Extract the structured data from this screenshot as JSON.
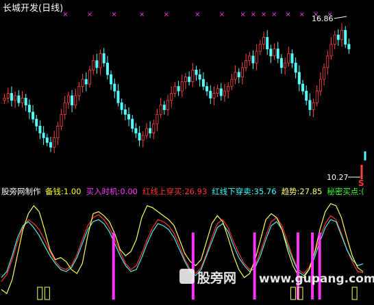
{
  "upper": {
    "title": "长城开发(日线)",
    "high_label": "16.86",
    "low_label": "10.27",
    "s_marker": "S"
  },
  "lower": {
    "source": "股旁网制作",
    "legend": [
      {
        "text": "备钱:1.00",
        "color": "#ffff00"
      },
      {
        "text": "买入时机:0.00",
        "color": "#ff33ff"
      },
      {
        "text": "红线上穿买:26.93",
        "color": "#ff3333"
      },
      {
        "text": "红线下穿卖:35.76",
        "color": "#33ffff"
      },
      {
        "text": "趋势:27.85",
        "color": "#ffff66"
      },
      {
        "text": "秘密买点:(",
        "color": "#33ff33"
      }
    ]
  },
  "watermark": {
    "brand": "股旁网",
    "url": "www.gupang.com"
  },
  "colors": {
    "up": "#ff4444",
    "down": "#54ffff",
    "magenta": "#ff33ff",
    "yellow": "#ffff55",
    "red": "#ff3333",
    "cyan": "#4df0f0"
  },
  "chart_data": [
    {
      "type": "candlestick",
      "title": "长城开发(日线)",
      "ylim": [
        10.27,
        16.86
      ],
      "annotations": [
        {
          "text": "16.86",
          "kind": "high"
        },
        {
          "text": "10.27",
          "kind": "low"
        }
      ],
      "closes": [
        13.5,
        13.7,
        13.4,
        13.6,
        13.3,
        13.5,
        13.2,
        12.9,
        12.6,
        12.3,
        12.0,
        11.8,
        11.6,
        11.4,
        11.8,
        12.3,
        12.8,
        13.3,
        13.6,
        13.2,
        13.6,
        14.0,
        14.3,
        14.1,
        14.7,
        15.1,
        14.8,
        15.4,
        15.0,
        14.5,
        14.1,
        13.8,
        13.3,
        13.0,
        12.8,
        12.6,
        12.2,
        12.0,
        11.7,
        11.9,
        12.2,
        12.0,
        12.4,
        12.8,
        13.2,
        13.0,
        13.4,
        13.7,
        14.0,
        13.8,
        14.2,
        14.4,
        14.2,
        14.7,
        14.5,
        14.3,
        14.0,
        13.8,
        13.5,
        13.7,
        13.9,
        13.6,
        13.8,
        14.0,
        14.3,
        14.6,
        14.4,
        14.8,
        15.1,
        15.3,
        15.0,
        15.5,
        15.8,
        16.1,
        15.6,
        15.3,
        15.6,
        15.2,
        14.8,
        15.0,
        15.4,
        15.0,
        14.6,
        14.1,
        13.8,
        13.4,
        13.0,
        13.3,
        13.8,
        14.3,
        14.8,
        15.3,
        15.8,
        16.2,
        16.0,
        16.4,
        15.8,
        15.6
      ],
      "markers": [
        0.18,
        0.25,
        0.32,
        0.4,
        0.47,
        0.56,
        0.63,
        0.69,
        0.72,
        0.75,
        0.78,
        0.82,
        0.86,
        0.9,
        0.94
      ],
      "tail_bars": [
        {
          "open": 10.9,
          "close": 10.27,
          "color": "up"
        },
        {
          "open": 11.1,
          "close": 11.5,
          "color": "down"
        }
      ]
    },
    {
      "type": "line",
      "ylim": [
        0,
        100
      ],
      "series": [
        {
          "name": "红线上穿买",
          "color": "red",
          "values": [
            18,
            25,
            40,
            58,
            72,
            80,
            76,
            70,
            60,
            48,
            38,
            32,
            30,
            34,
            45,
            60,
            74,
            82,
            85,
            80,
            72,
            60,
            48,
            36,
            30,
            34,
            46,
            60,
            72,
            80,
            78,
            74,
            66,
            54,
            40,
            30,
            26,
            32,
            46,
            62,
            76,
            80,
            72,
            58,
            46,
            36,
            30,
            34,
            48,
            64,
            78,
            82,
            74,
            58,
            42,
            30,
            26,
            32,
            46,
            62,
            76,
            84,
            80,
            66,
            50,
            38,
            28,
            26.93
          ]
        },
        {
          "name": "红线下穿卖",
          "color": "cyan",
          "values": [
            22,
            28,
            44,
            62,
            74,
            78,
            72,
            64,
            54,
            44,
            36,
            30,
            28,
            32,
            42,
            56,
            70,
            78,
            80,
            76,
            68,
            56,
            44,
            34,
            28,
            30,
            42,
            56,
            68,
            76,
            74,
            70,
            62,
            50,
            38,
            28,
            24,
            30,
            44,
            58,
            72,
            76,
            68,
            54,
            42,
            34,
            28,
            32,
            44,
            60,
            74,
            78,
            70,
            54,
            40,
            28,
            24,
            30,
            42,
            58,
            72,
            80,
            78,
            64,
            50,
            40,
            34,
            35.76
          ]
        },
        {
          "name": "趋势",
          "color": "yellow",
          "values": [
            10,
            6,
            20,
            45,
            70,
            86,
            94,
            88,
            70,
            50,
            40,
            42,
            38,
            30,
            26,
            36,
            64,
            86,
            88,
            84,
            78,
            66,
            50,
            44,
            48,
            60,
            82,
            94,
            92,
            88,
            84,
            80,
            74,
            60,
            46,
            38,
            34,
            40,
            58,
            76,
            84,
            78,
            62,
            44,
            30,
            22,
            26,
            40,
            60,
            80,
            86,
            82,
            70,
            50,
            34,
            24,
            22,
            30,
            46,
            70,
            88,
            96,
            94,
            82,
            62,
            44,
            32,
            27.85
          ]
        },
        {
          "name": "买入时机",
          "color": "magenta",
          "spikes": [
            0.31,
            0.53,
            0.7,
            0.82,
            0.86,
            0.88
          ]
        },
        {
          "name": "备钱",
          "color": "yellow",
          "steps": [
            0.1,
            0.12,
            0.8,
            0.82,
            0.97
          ]
        }
      ]
    }
  ]
}
